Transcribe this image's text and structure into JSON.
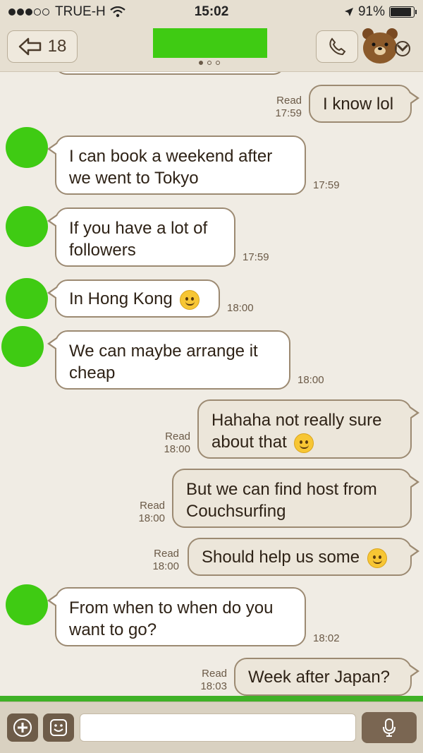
{
  "status_bar": {
    "carrier": "TRUE-H",
    "time": "15:02",
    "battery": "91%",
    "battery_level": 0.91
  },
  "header": {
    "back_count": "18"
  },
  "messages": [
    {
      "dir": "out",
      "text": "I know lol",
      "read": "Read",
      "time": "17:59"
    },
    {
      "dir": "in",
      "line1": "I can book a weekend after",
      "line2": "we went to Tokyo",
      "time": "17:59"
    },
    {
      "dir": "in",
      "line1": "If you have a lot of",
      "line2": "followers",
      "time": "17:59"
    },
    {
      "dir": "in",
      "text": "In Hong Kong",
      "emoji": "wink-emoji",
      "time": "18:00"
    },
    {
      "dir": "in",
      "line1": "We can maybe arrange it",
      "line2": "cheap",
      "time": "18:00"
    },
    {
      "dir": "out",
      "line1": "Hahaha not really sure",
      "line2": "about that",
      "emoji": "sweat-smile-emoji",
      "read": "Read",
      "time": "18:00"
    },
    {
      "dir": "out",
      "line1": "But we can find host from",
      "line2": "Couchsurfing",
      "read": "Read",
      "time": "18:00"
    },
    {
      "dir": "out",
      "text": "Should help us some",
      "emoji": "sweat-smile-emoji",
      "read": "Read",
      "time": "18:00"
    },
    {
      "dir": "in",
      "line1": "From when to when do you",
      "line2": "want to go?",
      "time": "18:02"
    },
    {
      "dir": "out",
      "text": "Week after Japan?",
      "read": "Read",
      "time": "18:03"
    }
  ],
  "colors": {
    "background": "#f0ece4",
    "bar": "#e6dfd1",
    "redaction_green": "#3fcb13",
    "accent_brown": "#6e5c49"
  }
}
